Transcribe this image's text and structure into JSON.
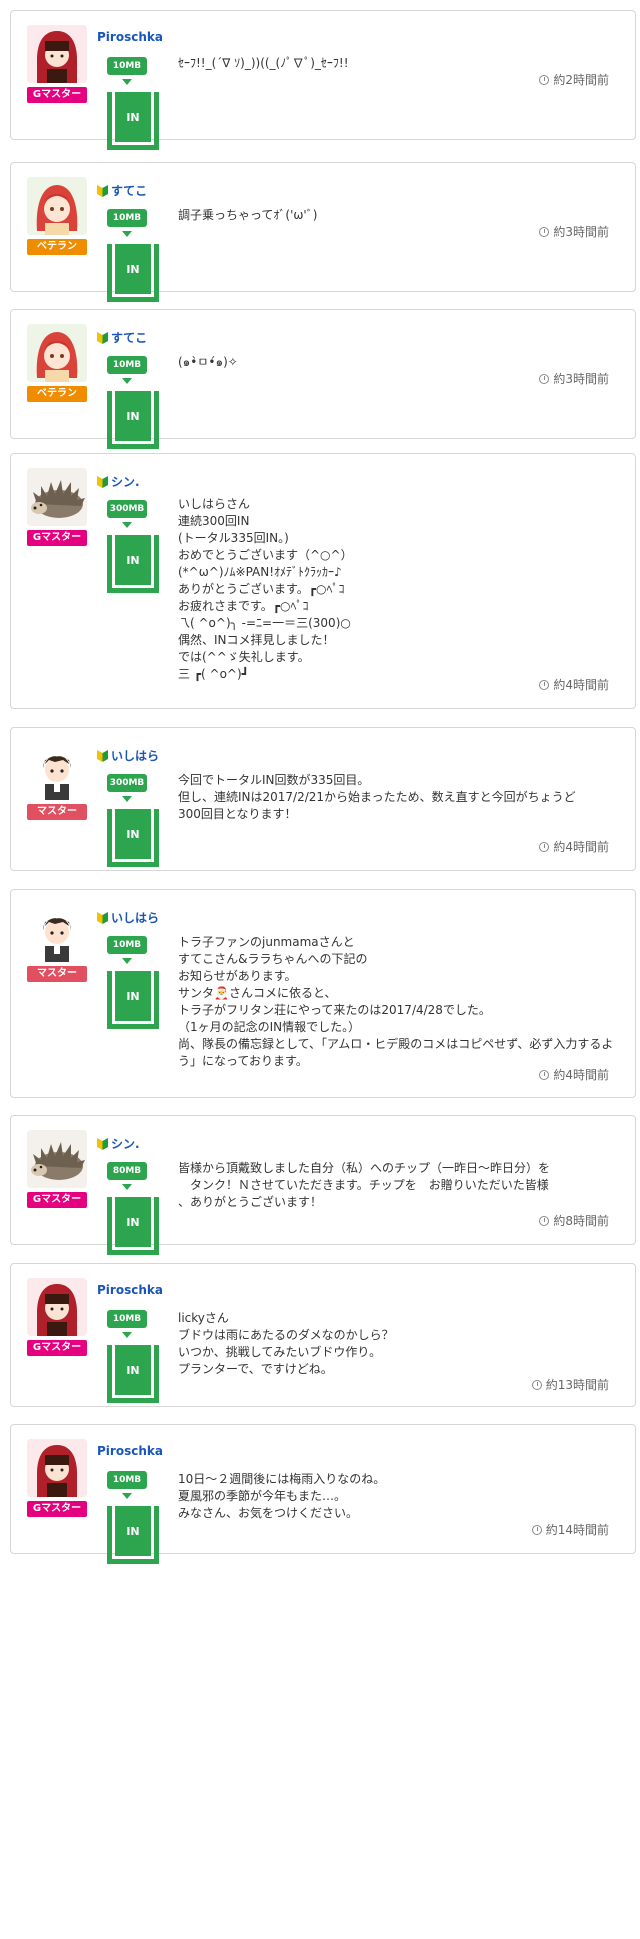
{
  "posts": [
    {
      "user": "Piroschka",
      "badge": "Gマスター",
      "mb": "10MB",
      "in": "IN",
      "text": "ｾｰﾌ!!_(´∇ ｿ)_))((_(ﾉﾟ∇ﾟ)_ｾｰﾌ!!",
      "time": "約2時間前"
    },
    {
      "user": "すてこ",
      "badge": "ベテラン",
      "mb": "10MB",
      "in": "IN",
      "text": "調子乗っちゃってｵﾞ('ω'ﾞ)",
      "time": "約3時間前"
    },
    {
      "user": "すてこ",
      "badge": "ベテラン",
      "mb": "10MB",
      "in": "IN",
      "text": "(๑•̀ㅁ•́๑)✧",
      "time": "約3時間前"
    },
    {
      "user": "シン.",
      "badge": "Gマスター",
      "mb": "300MB",
      "in": "IN",
      "text": "いしはらさん\n連続300回IN\n(トータル335回IN。)\nおめでとうございます（^○^）\n(*^ω^)ﾉﾑ※PAN!ｵﾒﾃﾞﾄｸﾗｯｶｰ♪\nありがとうございます。┏○ﾍﾟｺ\nお疲れさまです。┏○ﾍﾟｺ\n乁( ^o^)╮ -=ﾆ=一＝三(300)○\n偶然、INコメ拝見しました！\nでは(^^ゞ失礼します。\n三 ┏( ^o^)┛",
      "time": "約4時間前"
    },
    {
      "user": "いしはら",
      "badge": "マスター",
      "mb": "300MB",
      "in": "IN",
      "text": "今回でトータルIN回数が335回目。\n但し、連続INは2017/2/21から始まったため、数え直すと今回がちょうど\n300回目となります！",
      "time": "約4時間前"
    },
    {
      "user": "いしはら",
      "badge": "マスター",
      "mb": "10MB",
      "in": "IN",
      "text": "トラ子ファンのjunmamaさんと\nすてこさん&ララちゃんへの下記の\nお知らせがあります。\nサンタ🎅さんコメに依ると、\nトラ子がフリタン荘にやって来たのは2017/4/28でした。\n（1ヶ月の記念のIN情報でした。）\n尚、隊長の備忘録として、「アムロ・ヒデ殿のコメはコピペせず、必ず入力するよう」になっております。",
      "time": "約4時間前"
    },
    {
      "user": "シン.",
      "badge": "Gマスター",
      "mb": "80MB",
      "in": "IN",
      "text": "皆様から頂戴致しました自分（私）へのチップ（一昨日〜昨日分）を\n　タンク！Ｎさせていただきます。チップを　お贈りいただいた皆様\n、ありがとうございます！",
      "time": "約8時間前"
    },
    {
      "user": "Piroschka",
      "badge": "Gマスター",
      "mb": "10MB",
      "in": "IN",
      "text": "lickyさん\nブドウは雨にあたるのダメなのかしら？\nいつか、挑戦してみたいブドウ作り。\nプランターで、ですけどね。",
      "time": "約13時間前"
    },
    {
      "user": "Piroschka",
      "badge": "Gマスター",
      "mb": "10MB",
      "in": "IN",
      "text": "10日〜２週間後には梅雨入りなのね。\n夏風邪の季節が今年もまた…。\nみなさん、お気をつけください。",
      "time": "約14時間前"
    }
  ]
}
